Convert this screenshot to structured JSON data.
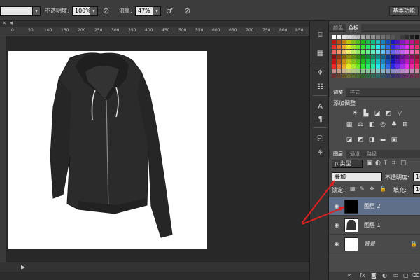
{
  "options_bar": {
    "opacity_label": "不透明度:",
    "opacity_value": "100%",
    "flow_label": "流量:",
    "flow_value": "47%",
    "workspace_button": "基本功能"
  },
  "document": {
    "ruler_ticks": [
      "0",
      "50",
      "100",
      "150",
      "200",
      "250",
      "300",
      "350",
      "400",
      "450",
      "500",
      "550",
      "600",
      "650",
      "700",
      "750",
      "800",
      "850"
    ]
  },
  "panels": {
    "color_tabs": [
      "颜色",
      "色板"
    ],
    "adjust_tabs": [
      "调整",
      "样式"
    ],
    "adjust_title": "添加调整",
    "layers_tabs": [
      "图层",
      "通道",
      "路径"
    ],
    "filter_type": "ρ 类型",
    "blend_mode": "叠加",
    "opacity_label": "不透明度:",
    "opacity_value": "10",
    "lock_label": "锁定:",
    "fill_label": "填充:",
    "fill_value": "10",
    "layers": [
      {
        "name": "图层 2",
        "selected": true
      },
      {
        "name": "图层 1",
        "selected": false
      },
      {
        "name": "背景",
        "selected": false
      }
    ],
    "footer_fx": "fx"
  },
  "colors": {
    "accent_arrow": "#e02020",
    "selected_layer": "#5f6f8a"
  }
}
